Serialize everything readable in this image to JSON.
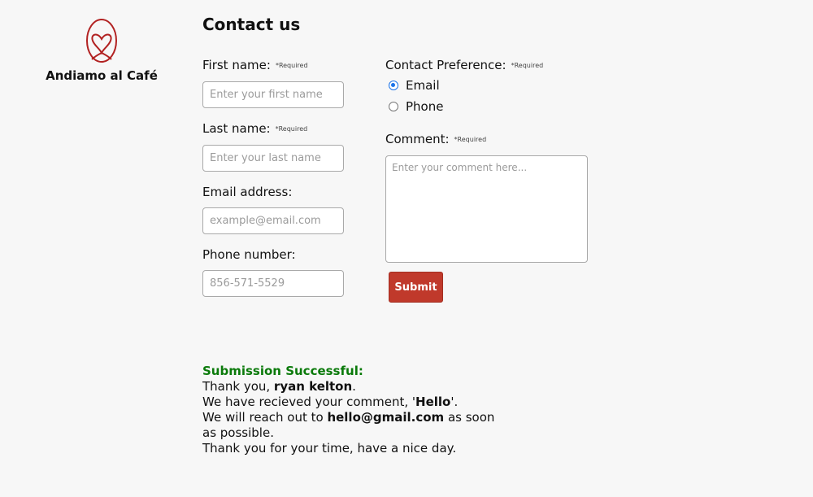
{
  "brand": {
    "name": "Andiamo al Café",
    "logo_icon": "heart-leaf-icon",
    "logo_color": "#b22222"
  },
  "page": {
    "title": "Contact us"
  },
  "form": {
    "required_tag": "*Required",
    "first_name": {
      "label": "First name:",
      "placeholder": "Enter your first name"
    },
    "last_name": {
      "label": "Last name:",
      "placeholder": "Enter your last name"
    },
    "email": {
      "label": "Email address:",
      "placeholder": "example@email.com"
    },
    "phone": {
      "label": "Phone number:",
      "placeholder": "856-571-5529"
    },
    "contact_pref": {
      "label": "Contact Preference:",
      "options": [
        "Email",
        "Phone"
      ],
      "selected": "Email"
    },
    "comment": {
      "label": "Comment:",
      "placeholder": "Enter your comment here..."
    },
    "submit_label": "Submit"
  },
  "result": {
    "title": "Submission Successful:",
    "line1_prefix": "Thank you, ",
    "name": "ryan kelton",
    "line1_suffix": ".",
    "line2_prefix": "We have recieved your comment, '",
    "comment": "Hello",
    "line2_suffix": "'.",
    "line3_prefix": "We will reach out to ",
    "email": "hello@gmail.com",
    "line3_suffix": " as soon as possible.",
    "line4": "Thank you for your time, have a nice day."
  },
  "colors": {
    "accent": "#c0392b",
    "success": "#0a7a0a",
    "radio": "#1a73e8"
  }
}
